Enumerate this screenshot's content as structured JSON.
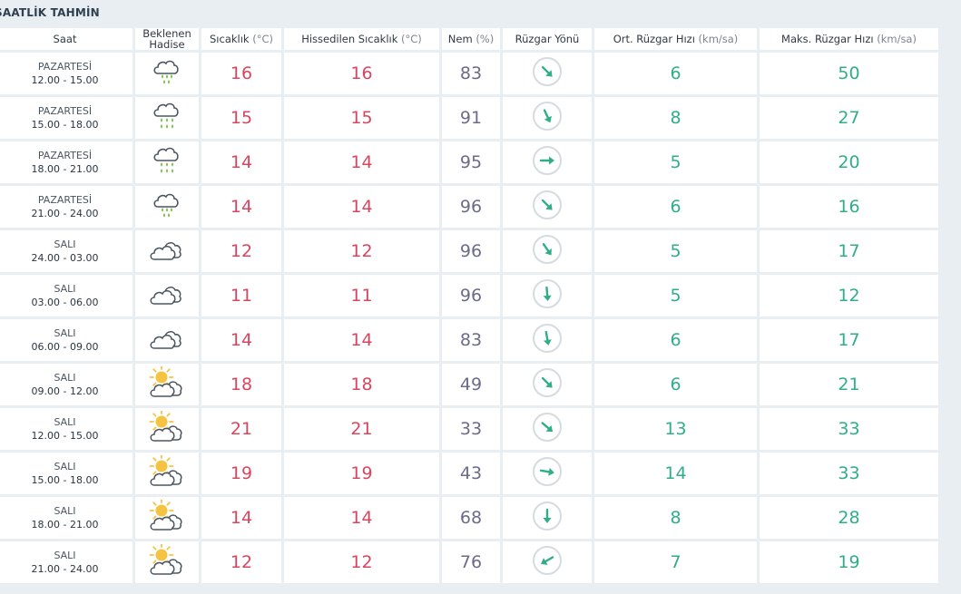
{
  "title": "SAATLİK TAHMİN",
  "headers": {
    "saat": "Saat",
    "hadise_1": "Beklenen",
    "hadise_2": "Hadise",
    "sicaklik": "Sıcaklık",
    "sicaklik_unit": "(°C)",
    "hissedilen": "Hissedilen Sıcaklık",
    "hissedilen_unit": "(°C)",
    "nem": "Nem",
    "nem_unit": "(%)",
    "ruzgar_yonu": "Rüzgar Yönü",
    "ort_ruzgar": "Ort. Rüzgar Hızı",
    "ort_ruzgar_unit": "(km/sa)",
    "maks_ruzgar": "Maks. Rüzgar Hızı",
    "maks_ruzgar_unit": "(km/sa)"
  },
  "colors": {
    "temperature": "#d9455f",
    "humidity": "#6d6a8a",
    "wind": "#2fae88",
    "rain": "#72bb3c",
    "sun": "#f5c342"
  },
  "rows": [
    {
      "day": "PAZARTESİ",
      "time": "12.00 - 15.00",
      "icon": "light-rain-icon",
      "temp": "16",
      "feels": "16",
      "humidity": "83",
      "wind_dir_deg": 135,
      "wind_avg": "6",
      "wind_max": "50"
    },
    {
      "day": "PAZARTESİ",
      "time": "15.00 - 18.00",
      "icon": "rain-icon",
      "temp": "15",
      "feels": "15",
      "humidity": "91",
      "wind_dir_deg": 155,
      "wind_avg": "8",
      "wind_max": "27"
    },
    {
      "day": "PAZARTESİ",
      "time": "18.00 - 21.00",
      "icon": "rain-icon",
      "temp": "14",
      "feels": "14",
      "humidity": "95",
      "wind_dir_deg": 90,
      "wind_avg": "5",
      "wind_max": "20"
    },
    {
      "day": "PAZARTESİ",
      "time": "21.00 - 24.00",
      "icon": "light-rain-icon",
      "temp": "14",
      "feels": "14",
      "humidity": "96",
      "wind_dir_deg": 135,
      "wind_avg": "6",
      "wind_max": "16"
    },
    {
      "day": "SALI",
      "time": "24.00 - 03.00",
      "icon": "cloudy-icon",
      "temp": "12",
      "feels": "12",
      "humidity": "96",
      "wind_dir_deg": 145,
      "wind_avg": "5",
      "wind_max": "17"
    },
    {
      "day": "SALI",
      "time": "03.00 - 06.00",
      "icon": "cloudy-icon",
      "temp": "11",
      "feels": "11",
      "humidity": "96",
      "wind_dir_deg": 175,
      "wind_avg": "5",
      "wind_max": "12"
    },
    {
      "day": "SALI",
      "time": "06.00 - 09.00",
      "icon": "cloudy-icon",
      "temp": "14",
      "feels": "14",
      "humidity": "83",
      "wind_dir_deg": 170,
      "wind_avg": "6",
      "wind_max": "17"
    },
    {
      "day": "SALI",
      "time": "09.00 - 12.00",
      "icon": "partly-cloudy-icon",
      "temp": "18",
      "feels": "18",
      "humidity": "49",
      "wind_dir_deg": 135,
      "wind_avg": "6",
      "wind_max": "21"
    },
    {
      "day": "SALI",
      "time": "12.00 - 15.00",
      "icon": "partly-cloudy-icon",
      "temp": "21",
      "feels": "21",
      "humidity": "33",
      "wind_dir_deg": 130,
      "wind_avg": "13",
      "wind_max": "33"
    },
    {
      "day": "SALI",
      "time": "15.00 - 18.00",
      "icon": "partly-cloudy-icon",
      "temp": "19",
      "feels": "19",
      "humidity": "43",
      "wind_dir_deg": 100,
      "wind_avg": "14",
      "wind_max": "33"
    },
    {
      "day": "SALI",
      "time": "18.00 - 21.00",
      "icon": "partly-cloudy-icon",
      "temp": "14",
      "feels": "14",
      "humidity": "68",
      "wind_dir_deg": 180,
      "wind_avg": "8",
      "wind_max": "28"
    },
    {
      "day": "SALI",
      "time": "21.00 - 24.00",
      "icon": "partly-cloudy-icon",
      "temp": "12",
      "feels": "12",
      "humidity": "76",
      "wind_dir_deg": 240,
      "wind_avg": "7",
      "wind_max": "19"
    }
  ]
}
